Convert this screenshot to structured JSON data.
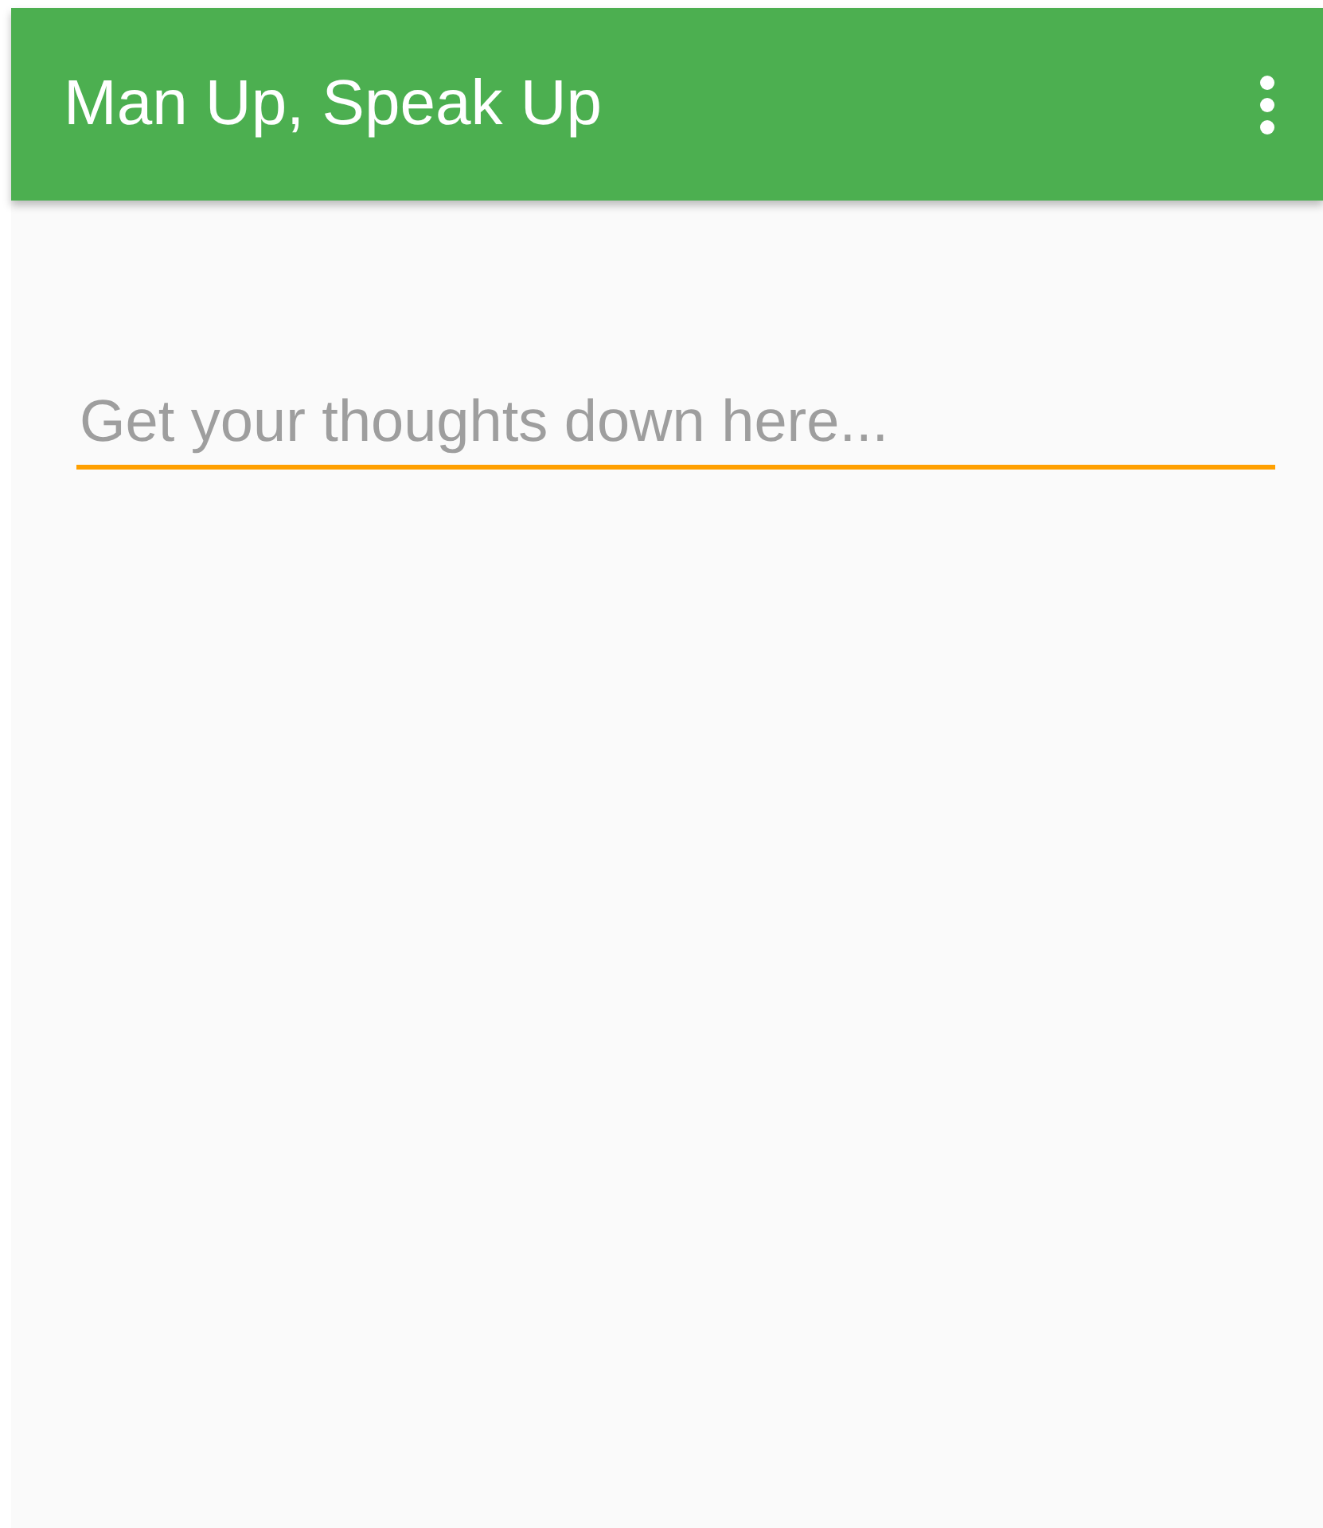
{
  "app_bar": {
    "title": "Man Up, Speak Up"
  },
  "text_field": {
    "placeholder": "Get your thoughts down here..."
  }
}
